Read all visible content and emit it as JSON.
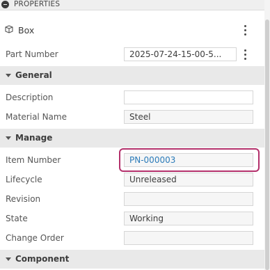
{
  "panel": {
    "title": "PROPERTIES"
  },
  "object": {
    "name": "Box",
    "icon": "cube-icon"
  },
  "part_number": {
    "label": "Part Number",
    "value": "2025-07-24-15-00-5..."
  },
  "general": {
    "title": "General",
    "description": {
      "label": "Description",
      "value": ""
    },
    "material_name": {
      "label": "Material Name",
      "value": "Steel"
    }
  },
  "manage": {
    "title": "Manage",
    "item_number": {
      "label": "Item Number",
      "value": "PN-000003"
    },
    "lifecycle": {
      "label": "Lifecycle",
      "value": "Unreleased"
    },
    "revision": {
      "label": "Revision",
      "value": ""
    },
    "state": {
      "label": "State",
      "value": "Working"
    },
    "change_order": {
      "label": "Change Order",
      "value": ""
    }
  },
  "component": {
    "title": "Component"
  },
  "colors": {
    "highlight": "#b3306b",
    "link": "#2b7bb9",
    "section_bg": "#e9e9e9"
  }
}
